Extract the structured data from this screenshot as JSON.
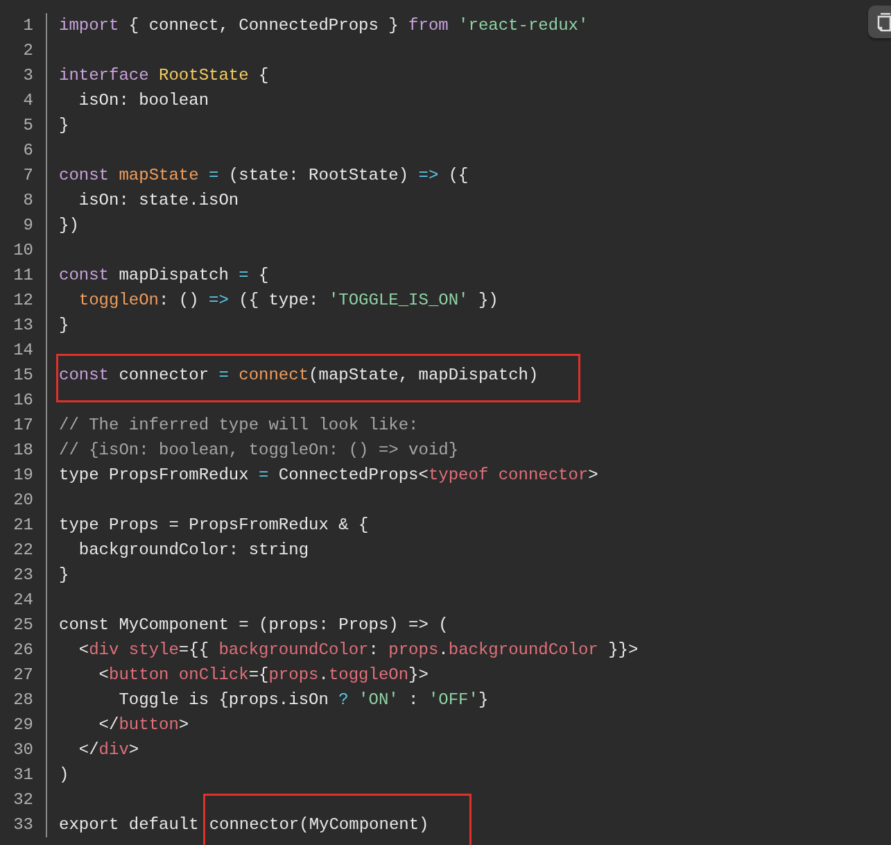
{
  "editor": {
    "lines": [
      {
        "number": "1",
        "tokens": [
          {
            "kind": "kw",
            "text": "import"
          },
          {
            "kind": "plain",
            "text": " { connect, ConnectedProps } "
          },
          {
            "kind": "kw",
            "text": "from"
          },
          {
            "kind": "str",
            "text": " 'react-redux'"
          }
        ]
      },
      {
        "number": "2"
      },
      {
        "number": "3",
        "tokens": [
          {
            "kind": "kw",
            "text": "interface"
          },
          {
            "kind": "type",
            "text": " RootState"
          },
          {
            "kind": "plain",
            "text": " {"
          }
        ]
      },
      {
        "number": "4",
        "tokens": [
          {
            "kind": "plain",
            "text": "  isOn: boolean"
          }
        ]
      },
      {
        "number": "5",
        "tokens": [
          {
            "kind": "plain",
            "text": "}"
          }
        ]
      },
      {
        "number": "6"
      },
      {
        "number": "7",
        "tokens": [
          {
            "kind": "kw",
            "text": "const"
          },
          {
            "kind": "fn",
            "text": " mapState"
          },
          {
            "kind": "op",
            "text": " ="
          },
          {
            "kind": "plain",
            "text": " (state: RootState) "
          },
          {
            "kind": "op",
            "text": "=>"
          },
          {
            "kind": "plain",
            "text": " ({"
          }
        ]
      },
      {
        "number": "8",
        "tokens": [
          {
            "kind": "plain",
            "text": "  isOn: state.isOn"
          }
        ]
      },
      {
        "number": "9",
        "tokens": [
          {
            "kind": "plain",
            "text": "})"
          }
        ]
      },
      {
        "number": "10"
      },
      {
        "number": "11",
        "tokens": [
          {
            "kind": "kw",
            "text": "const"
          },
          {
            "kind": "plain",
            "text": " mapDispatch "
          },
          {
            "kind": "op",
            "text": "="
          },
          {
            "kind": "plain",
            "text": " {"
          }
        ]
      },
      {
        "number": "12",
        "tokens": [
          {
            "kind": "fn",
            "text": "  toggleOn"
          },
          {
            "kind": "plain",
            "text": ": () "
          },
          {
            "kind": "op",
            "text": "=>"
          },
          {
            "kind": "plain",
            "text": " ({ type: "
          },
          {
            "kind": "str",
            "text": "'TOGGLE_IS_ON'"
          },
          {
            "kind": "plain",
            "text": " })"
          }
        ]
      },
      {
        "number": "13",
        "tokens": [
          {
            "kind": "plain",
            "text": "}"
          }
        ]
      },
      {
        "number": "14"
      },
      {
        "number": "15",
        "highlighted": [
          {
            "kind": "kw",
            "text": "const"
          },
          {
            "kind": "plain",
            "text": " connector "
          },
          {
            "kind": "op",
            "text": "="
          },
          {
            "kind": "fn",
            "text": " connect"
          },
          {
            "kind": "plain",
            "text": "(mapState, mapDispatch)"
          }
        ]
      },
      {
        "number": "16"
      },
      {
        "number": "17",
        "tokens": [
          {
            "kind": "comment",
            "text": "// The inferred type will look like:"
          }
        ]
      },
      {
        "number": "18",
        "tokens": [
          {
            "kind": "comment",
            "text": "// {isOn: boolean, toggleOn: () => void}"
          }
        ]
      },
      {
        "number": "19",
        "tokens": [
          {
            "kind": "plain",
            "text": "type PropsFromRedux "
          },
          {
            "kind": "op",
            "text": "="
          },
          {
            "kind": "plain",
            "text": " ConnectedProps<"
          },
          {
            "kind": "tag",
            "text": "typeof connector"
          },
          {
            "kind": "plain",
            "text": ">"
          }
        ]
      },
      {
        "number": "20"
      },
      {
        "number": "21",
        "tokens": [
          {
            "kind": "plain",
            "text": "type Props = PropsFromRedux & {"
          }
        ]
      },
      {
        "number": "22",
        "tokens": [
          {
            "kind": "plain",
            "text": "  backgroundColor: string"
          }
        ]
      },
      {
        "number": "23",
        "tokens": [
          {
            "kind": "plain",
            "text": "}"
          }
        ]
      },
      {
        "number": "24"
      },
      {
        "number": "25",
        "tokens": [
          {
            "kind": "plain",
            "text": "const MyComponent = (props: Props) => ("
          }
        ]
      },
      {
        "number": "26",
        "tokens": [
          {
            "kind": "plain",
            "text": "  <"
          },
          {
            "kind": "tag",
            "text": "div style"
          },
          {
            "kind": "plain",
            "text": "={{ "
          },
          {
            "kind": "tag",
            "text": "backgroundColor"
          },
          {
            "kind": "plain",
            "text": ": "
          },
          {
            "kind": "tag",
            "text": "props"
          },
          {
            "kind": "plain",
            "text": "."
          },
          {
            "kind": "tag",
            "text": "backgroundColor"
          },
          {
            "kind": "plain",
            "text": " }}>"
          }
        ]
      },
      {
        "number": "27",
        "tokens": [
          {
            "kind": "plain",
            "text": "    <"
          },
          {
            "kind": "tag",
            "text": "button onClick"
          },
          {
            "kind": "plain",
            "text": "={"
          },
          {
            "kind": "tag",
            "text": "props"
          },
          {
            "kind": "plain",
            "text": "."
          },
          {
            "kind": "tag",
            "text": "toggleOn"
          },
          {
            "kind": "plain",
            "text": "}>"
          }
        ]
      },
      {
        "number": "28",
        "tokens": [
          {
            "kind": "plain",
            "text": "      Toggle is {props.isOn "
          },
          {
            "kind": "op",
            "text": "?"
          },
          {
            "kind": "str",
            "text": " 'ON'"
          },
          {
            "kind": "plain",
            "text": " : "
          },
          {
            "kind": "str",
            "text": "'OFF'"
          },
          {
            "kind": "plain",
            "text": "}"
          }
        ]
      },
      {
        "number": "29",
        "tokens": [
          {
            "kind": "plain",
            "text": "    </"
          },
          {
            "kind": "tag",
            "text": "button"
          },
          {
            "kind": "plain",
            "text": ">"
          }
        ]
      },
      {
        "number": "30",
        "tokens": [
          {
            "kind": "plain",
            "text": "  </"
          },
          {
            "kind": "tag",
            "text": "div"
          },
          {
            "kind": "plain",
            "text": ">"
          }
        ]
      },
      {
        "number": "31",
        "tokens": [
          {
            "kind": "plain",
            "text": ")"
          }
        ]
      },
      {
        "number": "32"
      },
      {
        "number": "33",
        "tokens": [
          {
            "kind": "plain",
            "text": "export default"
          }
        ],
        "highlighted": [
          {
            "kind": "plain",
            "text": "connector(MyComponent)"
          }
        ]
      }
    ]
  }
}
